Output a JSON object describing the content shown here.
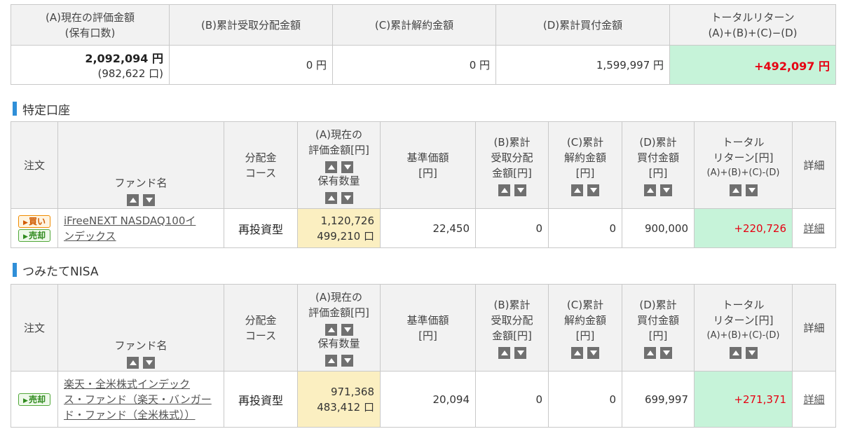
{
  "summary": {
    "headers": [
      "(A)現在の評価金額",
      "(保有口数)",
      "(B)累計受取分配金額",
      "(C)累計解約金額",
      "(D)累計買付金額",
      "トータルリターン",
      "(A)+(B)+(C)−(D)"
    ],
    "valuation": "2,092,094 円",
    "units": "(982,622 口)",
    "dividends": "0 円",
    "cancellation": "0 円",
    "purchase": "1,599,997 円",
    "total_return": "+492,097 円"
  },
  "col_headers": {
    "order": "注文",
    "fund_name": "ファンド名",
    "course_l1": "分配金",
    "course_l2": "コース",
    "val_l1": "(A)現在の",
    "val_l2": "評価金額[円]",
    "val_l3": "保有数量",
    "base_l1": "基準価額",
    "base_l2": "[円]",
    "div_l1": "(B)累計",
    "div_l2": "受取分配",
    "div_l3": "金額[円]",
    "can_l1": "(C)累計",
    "can_l2": "解約金額",
    "can_l3": "[円]",
    "pur_l1": "(D)累計",
    "pur_l2": "買付金額",
    "pur_l3": "[円]",
    "ret_l1": "トータル",
    "ret_l2": "リターン[円]",
    "ret_l3": "(A)+(B)+(C)-(D)",
    "detail": "詳細"
  },
  "sections": [
    {
      "title": "特定口座",
      "fund": {
        "buy_label": "買い",
        "sell_label": "売却",
        "name_l1": "iFreeNEXT NASDAQ100イ",
        "name_l2": "ンデックス",
        "name_l3": "",
        "course": "再投資型",
        "valuation": "1,120,726",
        "units": "499,210 口",
        "base_price": "22,450",
        "dividends": "0",
        "cancellation": "0",
        "purchase": "900,000",
        "total_return": "+220,726",
        "detail": "詳細"
      }
    },
    {
      "title": "つみたてNISA",
      "fund": {
        "sell_label": "売却",
        "name_l1": "楽天・全米株式インデック",
        "name_l2": "ス・ファンド（楽天・バンガー",
        "name_l3": "ド・ファンド（全米株式））",
        "course": "再投資型",
        "valuation": "971,368",
        "units": "483,412 口",
        "base_price": "20,094",
        "dividends": "0",
        "cancellation": "0",
        "purchase": "699,997",
        "total_return": "+271,371",
        "detail": "詳細"
      }
    }
  ],
  "colors": {
    "accent_blue": "#2f8fd8",
    "return_green": "#c6f3d9",
    "value_yellow": "#fbefc1",
    "positive_red": "#e60012"
  },
  "icons": [
    "sort-asc-icon",
    "sort-desc-icon",
    "section-bar-icon"
  ]
}
